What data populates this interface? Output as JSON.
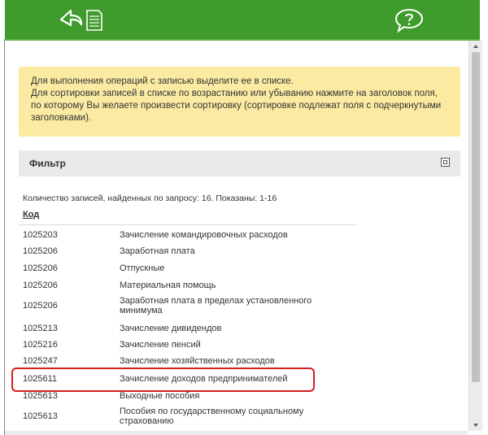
{
  "toolbar": {
    "back_icon": "back-arrow-document-icon",
    "help_icon": "help-speech-bubble-icon",
    "accent": "#3f9b2b"
  },
  "notice": {
    "line1": "Для выполнения операций с записью выделите ее в списке.",
    "line2": "Для сортировки записей в списке по возрастанию или убыванию нажмите на заголовок поля, по которому Вы желаете произвести сортировку (сортировке подлежат поля с подчеркнутыми заголовками)."
  },
  "filter": {
    "title": "Фильтр"
  },
  "results": {
    "count_text": "Количество  записей, найденных по запросу: 16.  Показаны:  1-16",
    "column_code": "Код",
    "rows": [
      {
        "code": "1025203",
        "name": "Зачисление командировочных расходов"
      },
      {
        "code": "1025206",
        "name": "Заработная плата"
      },
      {
        "code": "1025206",
        "name": "Отпускные"
      },
      {
        "code": "1025206",
        "name": "Материальная помощь"
      },
      {
        "code": "1025206",
        "name": "Заработная плата в пределах установленного минимума"
      },
      {
        "code": "1025213",
        "name": "Зачисление дивидендов"
      },
      {
        "code": "1025216",
        "name": "Зачисление пенсий"
      },
      {
        "code": "1025247",
        "name": "Зачисление хозяйственных расходов"
      },
      {
        "code": "1025611",
        "name": "Зачисление доходов предпринимателей"
      },
      {
        "code": "1025613",
        "name": "Выходные пособия"
      },
      {
        "code": "1025613",
        "name": "Пособия по государственному социальному страхованию"
      }
    ]
  }
}
